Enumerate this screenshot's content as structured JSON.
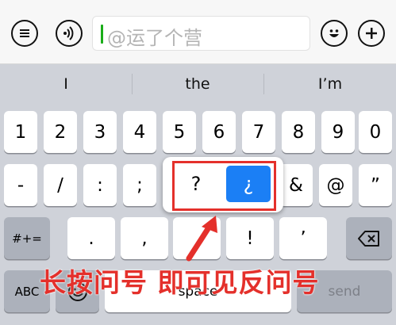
{
  "input_bar": {
    "list_icon": "list-bubble-icon",
    "voice_icon": "voice-wave-icon",
    "text": "@运了个营",
    "emoji_icon": "smiley-icon",
    "add_icon": "plus-icon"
  },
  "suggestions": [
    "I",
    "the",
    "I’m"
  ],
  "keyboard": {
    "row1": [
      "1",
      "2",
      "3",
      "4",
      "5",
      "6",
      "7",
      "8",
      "9",
      "0"
    ],
    "row2": [
      "-",
      "/",
      ":",
      ";",
      "&",
      "@",
      "”"
    ],
    "row3_mode": "#+=",
    "row3": [
      ".",
      ",",
      "!",
      "’"
    ],
    "backspace_icon": "backspace-icon",
    "abc": "ABC",
    "emoji_key_icon": "emoji-key-icon",
    "space": "space",
    "send": "send"
  },
  "popup": {
    "options": [
      "?",
      "¿"
    ],
    "selected": "¿"
  },
  "annotation": {
    "caption": "长按问号 即可见反问号",
    "color": "#e4302b"
  }
}
